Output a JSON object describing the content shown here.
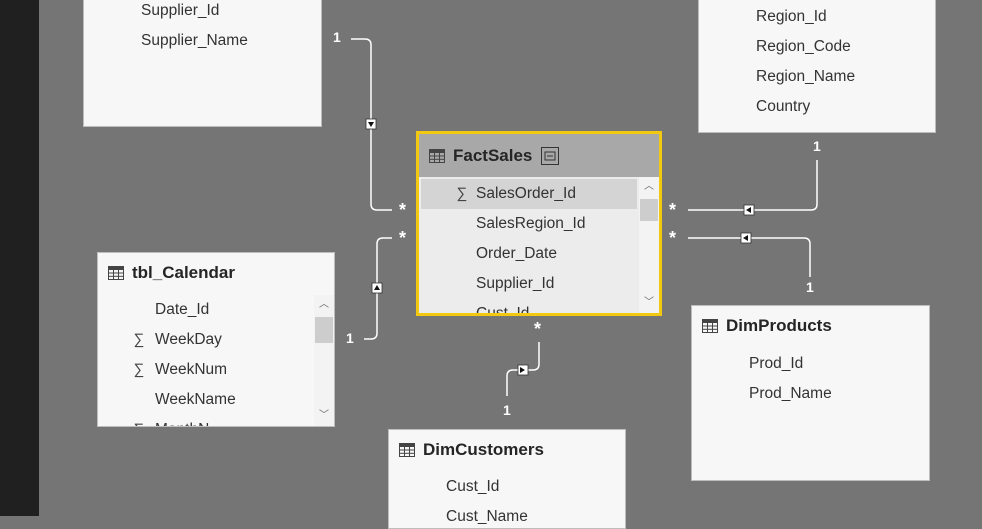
{
  "tables": {
    "supplier": {
      "fields": [
        "Supplier_Id",
        "Supplier_Name"
      ]
    },
    "region": {
      "fields": [
        "Region_Id",
        "Region_Code",
        "Region_Name",
        "Country"
      ]
    },
    "factsales": {
      "title": "FactSales",
      "fields": [
        "SalesOrder_Id",
        "SalesRegion_Id",
        "Order_Date",
        "Supplier_Id",
        "Cust_Id"
      ],
      "sum_field": "∑"
    },
    "calendar": {
      "title": "tbl_Calendar",
      "fields": [
        "Date_Id",
        "WeekDay",
        "WeekNum",
        "WeekName",
        "MonthN..."
      ],
      "sum_field": "∑"
    },
    "products": {
      "title": "DimProducts",
      "fields": [
        "Prod_Id",
        "Prod_Name"
      ]
    },
    "customers": {
      "title": "DimCustomers",
      "fields": [
        "Cust_Id",
        "Cust_Name"
      ]
    }
  },
  "cardinality": {
    "one": "1",
    "many": "*"
  },
  "colors": {
    "canvas": "#757575",
    "left_rail": "#202020",
    "card_bg": "#f7f7f7",
    "selected_border": "#f2c811",
    "selected_header": "#a8a8a8",
    "relationship_line": "#ffffff"
  },
  "icons": {
    "table": "table-icon",
    "sum": "sigma-icon",
    "collapse": "collapse-icon",
    "scroll_up": "chevron-up-icon",
    "scroll_down": "chevron-down-icon",
    "direction": "filter-direction-arrow-icon"
  }
}
